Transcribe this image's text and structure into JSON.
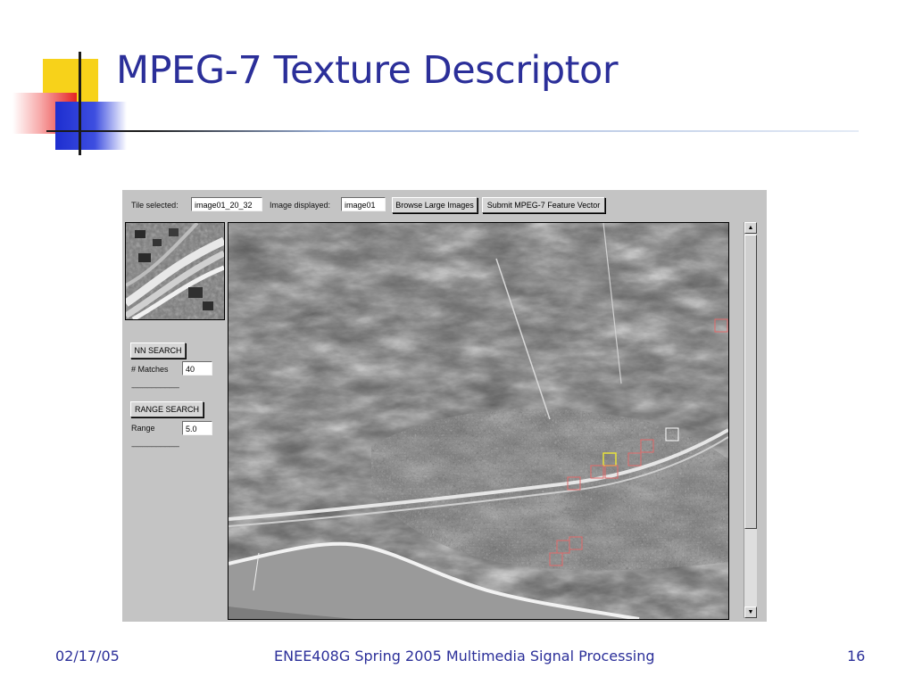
{
  "slide": {
    "title": "MPEG-7 Texture Descriptor"
  },
  "toolbar": {
    "tile_selected_label": "Tile selected:",
    "tile_selected_value": "image01_20_32",
    "image_displayed_label": "Image displayed:",
    "image_displayed_value": "image01",
    "browse_button": "Browse Large Images",
    "submit_button": "Submit MPEG-7 Feature Vector"
  },
  "search": {
    "nn_button": "NN SEARCH",
    "matches_label": "# Matches",
    "matches_value": "40",
    "separator": "--------------------------------",
    "range_button": "RANGE SEARCH",
    "range_label": "Range",
    "range_value": "5.0"
  },
  "footer": {
    "date": "02/17/05",
    "course": "ENEE408G Spring  2005 Multimedia Signal Processing",
    "page": "16"
  },
  "colors": {
    "title": "#2b2f99",
    "panel": "#c4c4c4",
    "selected_tile": "#e8e23a",
    "match_tile": "#e06a6a",
    "highlight_tile": "#ffffff"
  },
  "icons": {
    "scroll_up": "triangle-up",
    "scroll_down": "triangle-down"
  }
}
